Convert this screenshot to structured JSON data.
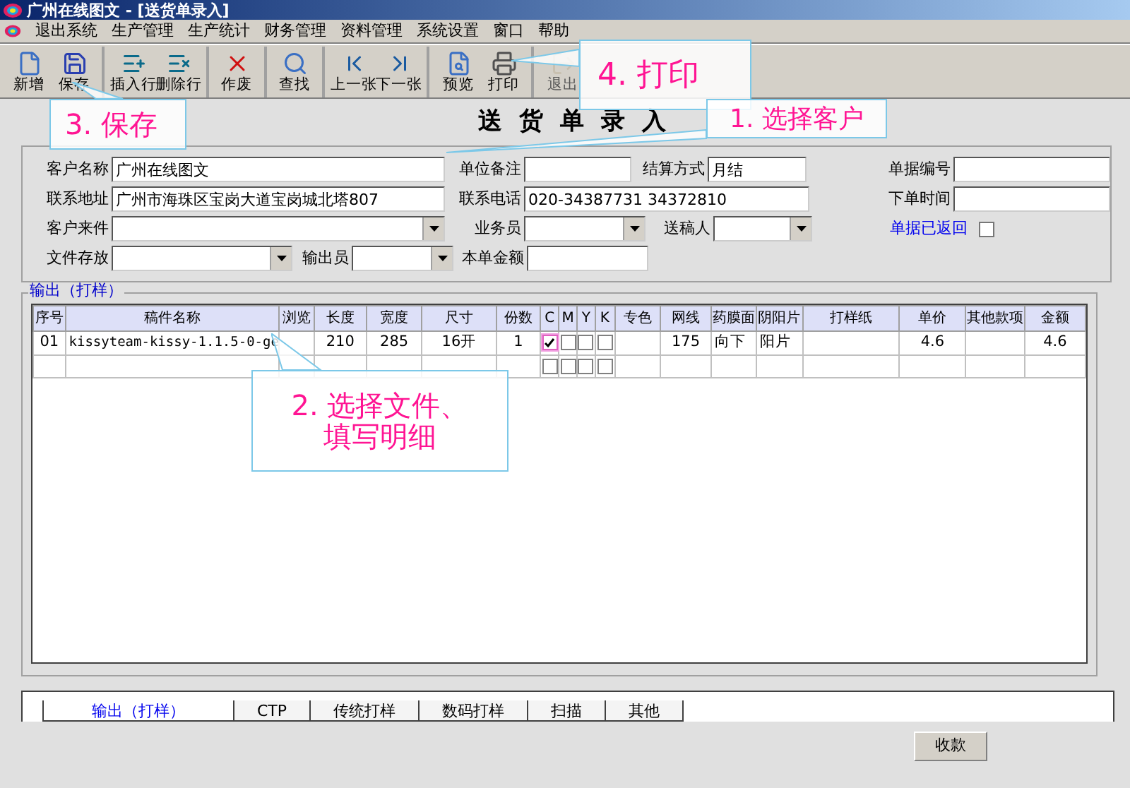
{
  "window": {
    "title": "广州在线图文 - [送货单录入]"
  },
  "menu": [
    "退出系统",
    "生产管理",
    "生产统计",
    "财务管理",
    "资料管理",
    "系统设置",
    "窗口",
    "帮助"
  ],
  "toolbar": [
    {
      "label": "新增",
      "disabled": false,
      "separator_after": false
    },
    {
      "label": "保存",
      "disabled": false,
      "separator_after": true
    },
    {
      "label": "插入行",
      "disabled": false,
      "separator_after": false
    },
    {
      "label": "删除行",
      "disabled": false,
      "separator_after": true
    },
    {
      "label": "作废",
      "disabled": false,
      "separator_after": true
    },
    {
      "label": "查找",
      "disabled": false,
      "separator_after": true
    },
    {
      "label": "上一张",
      "disabled": false,
      "separator_after": false
    },
    {
      "label": "下一张",
      "disabled": false,
      "separator_after": true
    },
    {
      "label": "预览",
      "disabled": false,
      "separator_after": false
    },
    {
      "label": "打印",
      "disabled": false,
      "separator_after": true
    },
    {
      "label": "退出",
      "disabled": true,
      "separator_after": false
    }
  ],
  "form_title": "送货单录入",
  "form": {
    "fields": [
      {
        "label": "客户名称",
        "kind": "text",
        "value": "广州在线图文"
      },
      {
        "label": "单位备注",
        "kind": "text"
      },
      {
        "label": "结算方式",
        "kind": "text",
        "value": "月结"
      },
      {
        "label": "联系地址",
        "kind": "text",
        "value": "广州市海珠区宝岗大道宝岗城北塔807"
      },
      {
        "label": "联系电话",
        "kind": "text",
        "value": "020-34387731 34372810"
      },
      {
        "label": "客户来件",
        "kind": "combo"
      },
      {
        "label": "业务员",
        "kind": "combo"
      },
      {
        "label": "送稿人",
        "kind": "combo"
      },
      {
        "label": "文件存放",
        "kind": "combo"
      },
      {
        "label": "输出员",
        "kind": "combo"
      },
      {
        "label": "本单金额",
        "kind": "text"
      },
      {
        "label": "单据编号",
        "kind": "text"
      },
      {
        "label": "下单时间",
        "kind": "text"
      },
      {
        "label": "单据已返回",
        "kind": "checkbox",
        "checked": false
      }
    ]
  },
  "output": {
    "legend": "输出（打样）",
    "columns": [
      "序号",
      "稿件名称",
      "浏览",
      "长度",
      "宽度",
      "尺寸",
      "份数",
      "C",
      "M",
      "Y",
      "K",
      "专色",
      "网线",
      "药膜面",
      "阴阳片",
      "打样纸",
      "单价",
      "其他款项",
      "金额"
    ],
    "rows": [
      {
        "cells": [
          "01",
          "kissyteam-kissy-1.1.5-0-ge",
          null,
          "210",
          "285",
          "16开",
          "1",
          true,
          false,
          false,
          false,
          null,
          "175",
          "向下",
          "阳片",
          null,
          "4.6",
          null,
          "4.6"
        ]
      },
      {
        "cells": [
          null,
          null,
          null,
          null,
          null,
          null,
          null,
          false,
          false,
          false,
          false,
          null,
          null,
          null,
          null,
          null,
          null,
          null,
          null
        ]
      }
    ]
  },
  "tabs": [
    {
      "label": "输出（打样）",
      "selected": true
    },
    {
      "label": "CTP",
      "selected": false
    },
    {
      "label": "传统打样",
      "selected": false
    },
    {
      "label": "数码打样",
      "selected": false
    },
    {
      "label": "扫描",
      "selected": false
    },
    {
      "label": "其他",
      "selected": false
    }
  ],
  "button": "收款",
  "callouts": [
    {
      "text": "4. 打印"
    },
    {
      "text": "3. 保存"
    },
    {
      "text": "1. 选择客户"
    },
    {
      "text": "2. 选择文件、填写明细"
    }
  ]
}
